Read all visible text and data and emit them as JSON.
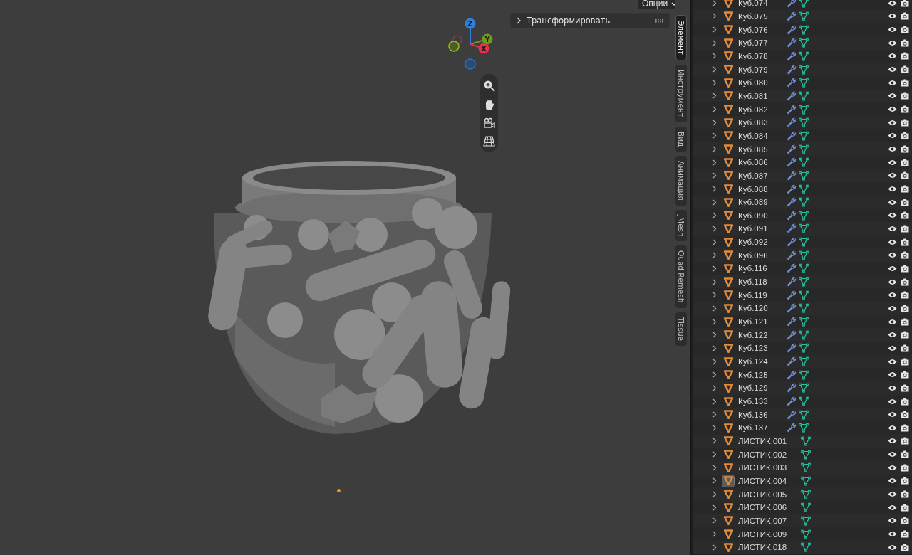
{
  "viewport": {
    "options_menu": {
      "label": "Опции"
    },
    "transform_panel": {
      "label": "Трансформировать",
      "expanded": false
    },
    "gizmo": {
      "axes": [
        {
          "label": "Z"
        },
        {
          "label": "Y"
        },
        {
          "label": "X"
        }
      ]
    }
  },
  "sidebar_tabs": [
    {
      "label": "Элемент",
      "selected": true
    },
    {
      "label": "Инструмент",
      "selected": false
    },
    {
      "label": "Вид",
      "selected": false
    },
    {
      "label": "Анимация",
      "selected": false
    },
    {
      "label": "JMesh",
      "selected": false
    },
    {
      "label": "Quad Remesh",
      "selected": false
    },
    {
      "label": "Tissue",
      "selected": false
    }
  ],
  "outliner": {
    "rows": [
      {
        "name": "Куб.074",
        "modifier": true,
        "active": false
      },
      {
        "name": "Куб.075",
        "modifier": true,
        "active": false
      },
      {
        "name": "Куб.076",
        "modifier": true,
        "active": false
      },
      {
        "name": "Куб.077",
        "modifier": true,
        "active": false
      },
      {
        "name": "Куб.078",
        "modifier": true,
        "active": false
      },
      {
        "name": "Куб.079",
        "modifier": true,
        "active": false
      },
      {
        "name": "Куб.080",
        "modifier": true,
        "active": false
      },
      {
        "name": "Куб.081",
        "modifier": true,
        "active": false
      },
      {
        "name": "Куб.082",
        "modifier": true,
        "active": false
      },
      {
        "name": "Куб.083",
        "modifier": true,
        "active": false
      },
      {
        "name": "Куб.084",
        "modifier": true,
        "active": false
      },
      {
        "name": "Куб.085",
        "modifier": true,
        "active": false
      },
      {
        "name": "Куб.086",
        "modifier": true,
        "active": false
      },
      {
        "name": "Куб.087",
        "modifier": true,
        "active": false
      },
      {
        "name": "Куб.088",
        "modifier": true,
        "active": false
      },
      {
        "name": "Куб.089",
        "modifier": true,
        "active": false
      },
      {
        "name": "Куб.090",
        "modifier": true,
        "active": false
      },
      {
        "name": "Куб.091",
        "modifier": true,
        "active": false
      },
      {
        "name": "Куб.092",
        "modifier": true,
        "active": false
      },
      {
        "name": "Куб.096",
        "modifier": true,
        "active": false
      },
      {
        "name": "Куб.116",
        "modifier": true,
        "active": false
      },
      {
        "name": "Куб.118",
        "modifier": true,
        "active": false
      },
      {
        "name": "Куб.119",
        "modifier": true,
        "active": false
      },
      {
        "name": "Куб.120",
        "modifier": true,
        "active": false
      },
      {
        "name": "Куб.121",
        "modifier": true,
        "active": false
      },
      {
        "name": "Куб.122",
        "modifier": true,
        "active": false
      },
      {
        "name": "Куб.123",
        "modifier": true,
        "active": false
      },
      {
        "name": "Куб.124",
        "modifier": true,
        "active": false
      },
      {
        "name": "Куб.125",
        "modifier": true,
        "active": false
      },
      {
        "name": "Куб.129",
        "modifier": true,
        "active": false
      },
      {
        "name": "Куб.133",
        "modifier": true,
        "active": false
      },
      {
        "name": "Куб.136",
        "modifier": true,
        "active": false
      },
      {
        "name": "Куб.137",
        "modifier": true,
        "active": false
      },
      {
        "name": "ЛИСТИК.001",
        "modifier": false,
        "active": false
      },
      {
        "name": "ЛИСТИК.002",
        "modifier": false,
        "active": false
      },
      {
        "name": "ЛИСТИК.003",
        "modifier": false,
        "active": false
      },
      {
        "name": "ЛИСТИК.004",
        "modifier": false,
        "active": true
      },
      {
        "name": "ЛИСТИК.005",
        "modifier": false,
        "active": false
      },
      {
        "name": "ЛИСТИК.006",
        "modifier": false,
        "active": false
      },
      {
        "name": "ЛИСТИК.007",
        "modifier": false,
        "active": false
      },
      {
        "name": "ЛИСТИК.009",
        "modifier": false,
        "active": false
      },
      {
        "name": "ЛИСТИК.018",
        "modifier": false,
        "active": false
      }
    ]
  }
}
